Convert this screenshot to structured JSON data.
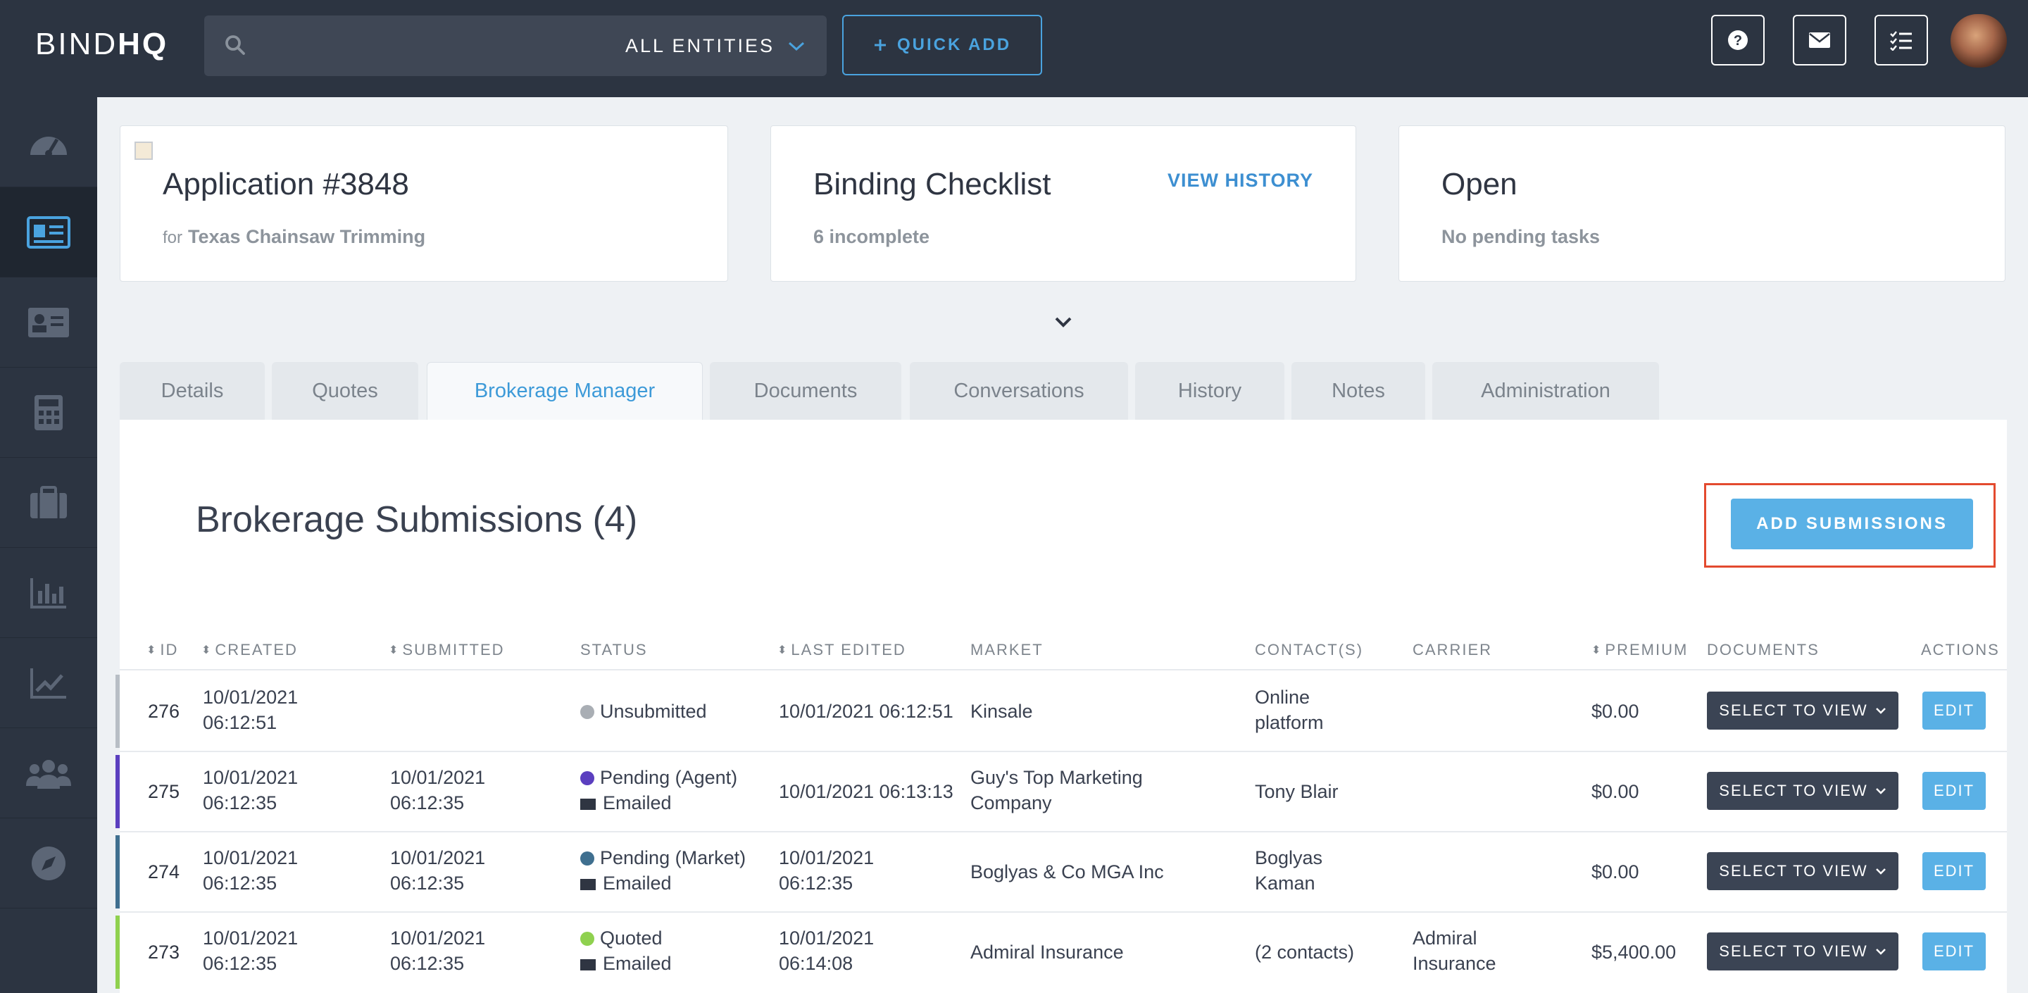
{
  "header": {
    "logo_light": "BIND",
    "logo_bold": "HQ",
    "search_placeholder": "",
    "entities_label": "ALL ENTITIES",
    "quick_add_label": "QUICK ADD"
  },
  "cards": {
    "application": {
      "title": "Application #3848",
      "for_label": "for",
      "insured": "Texas Chainsaw Trimming"
    },
    "checklist": {
      "title": "Binding Checklist",
      "link": "VIEW HISTORY",
      "subtitle": "6 incomplete"
    },
    "status": {
      "title": "Open",
      "subtitle": "No pending tasks"
    }
  },
  "tabs": [
    "Details",
    "Quotes",
    "Brokerage Manager",
    "Documents",
    "Conversations",
    "History",
    "Notes",
    "Administration"
  ],
  "active_tab": "Brokerage Manager",
  "section": {
    "title": "Brokerage Submissions (4)",
    "add_button": "ADD SUBMISSIONS"
  },
  "table": {
    "columns": [
      "ID",
      "CREATED",
      "SUBMITTED",
      "STATUS",
      "LAST EDITED",
      "MARKET",
      "CONTACT(S)",
      "CARRIER",
      "PREMIUM",
      "DOCUMENTS",
      "ACTIONS"
    ],
    "select_label": "SELECT TO VIEW",
    "edit_label": "EDIT",
    "rows": [
      {
        "id": "276",
        "created_date": "10/01/2021",
        "created_time": "06:12:51",
        "submitted_date": "",
        "submitted_time": "",
        "status": "Unsubmitted",
        "status_color": "#a9aeb4",
        "sub_status": "",
        "last_edited_1": "10/01/2021 06:12:51",
        "last_edited_2": "",
        "market_1": "Kinsale",
        "market_2": "",
        "contact_1": "Online",
        "contact_2": "platform",
        "carrier_1": "",
        "carrier_2": "",
        "premium": "$0.00",
        "stripe": "#b8bec5"
      },
      {
        "id": "275",
        "created_date": "10/01/2021",
        "created_time": "06:12:35",
        "submitted_date": "10/01/2021",
        "submitted_time": "06:12:35",
        "status": "Pending (Agent)",
        "status_color": "#5b3fbf",
        "sub_status": "Emailed",
        "last_edited_1": "10/01/2021 06:13:13",
        "last_edited_2": "",
        "market_1": "Guy's Top Marketing",
        "market_2": "Company",
        "contact_1": "Tony Blair",
        "contact_2": "",
        "carrier_1": "",
        "carrier_2": "",
        "premium": "$0.00",
        "stripe": "#5b3fbf"
      },
      {
        "id": "274",
        "created_date": "10/01/2021",
        "created_time": "06:12:35",
        "submitted_date": "10/01/2021",
        "submitted_time": "06:12:35",
        "status": "Pending (Market)",
        "status_color": "#3f6f8f",
        "sub_status": "Emailed",
        "last_edited_1": "10/01/2021",
        "last_edited_2": "06:12:35",
        "market_1": "Boglyas & Co MGA Inc",
        "market_2": "",
        "contact_1": "Boglyas",
        "contact_2": "Kaman",
        "carrier_1": "",
        "carrier_2": "",
        "premium": "$0.00",
        "stripe": "#3f6f8f"
      },
      {
        "id": "273",
        "created_date": "10/01/2021",
        "created_time": "06:12:35",
        "submitted_date": "10/01/2021",
        "submitted_time": "06:12:35",
        "status": "Quoted",
        "status_color": "#8fd14f",
        "sub_status": "Emailed",
        "last_edited_1": "10/01/2021",
        "last_edited_2": "06:14:08",
        "market_1": "Admiral Insurance",
        "market_2": "",
        "contact_1": "(2 contacts)",
        "contact_2": "",
        "carrier_1": "Admiral",
        "carrier_2": "Insurance",
        "premium": "$5,400.00",
        "stripe": "#8fd14f"
      }
    ]
  },
  "colors": {
    "nav_bg": "#2c3441",
    "accent": "#5ab1e6",
    "highlight": "#e34a2f"
  },
  "icons": {
    "sidebar": [
      "dashboard-icon",
      "id-card-icon",
      "contact-card-icon",
      "calculator-icon",
      "briefcase-icon",
      "bar-chart-icon",
      "trend-chart-icon",
      "users-icon",
      "compass-icon"
    ],
    "header": [
      "help-icon",
      "mail-icon",
      "checklist-icon"
    ]
  }
}
